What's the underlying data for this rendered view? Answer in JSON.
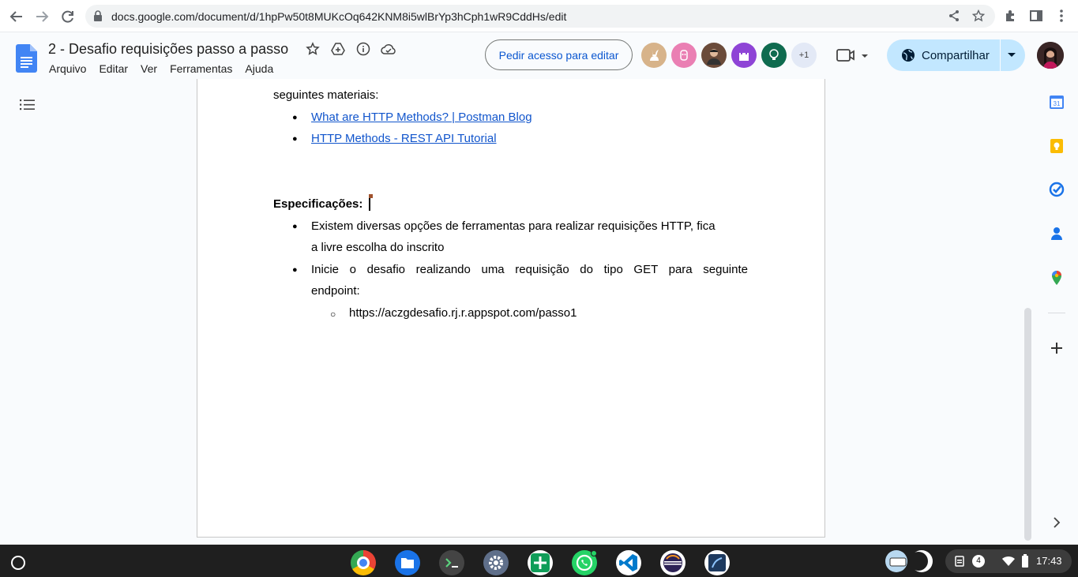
{
  "browser": {
    "url": "docs.google.com/document/d/1hpPw50t8MUKcOq642KNM8i5wlBrYp3hCph1wR9CddHs/edit"
  },
  "docs": {
    "title": "2 - Desafio requisições passo a passo",
    "menu": [
      "Arquivo",
      "Editar",
      "Ver",
      "Ferramentas",
      "Ajuda"
    ],
    "request_edit_label": "Pedir acesso para editar",
    "more_collaborators": "+1",
    "share_label": "Compartilhar"
  },
  "document": {
    "intro_tail": "seguintes materiais:",
    "links": [
      "What are HTTP Methods? | Postman Blog",
      "HTTP Methods - REST API Tutorial"
    ],
    "heading": "Especificações:",
    "bullet1_line1": "Existem diversas opções de ferramentas para realizar requisições HTTP, fica",
    "bullet1_line2": "a livre escolha do inscrito",
    "bullet2_line1": "Inicie o desafio realizando uma requisição do tipo GET para seguinte",
    "bullet2_line2": "endpoint:",
    "sub_bullet": "https://aczgdesafio.rj.r.appspot.com/passo1"
  },
  "taskbar": {
    "notification_count": "4",
    "time": "17:43"
  },
  "colors": {
    "accent": "#0b57d0",
    "share_bg": "#c2e7ff",
    "link": "#1155cc"
  }
}
